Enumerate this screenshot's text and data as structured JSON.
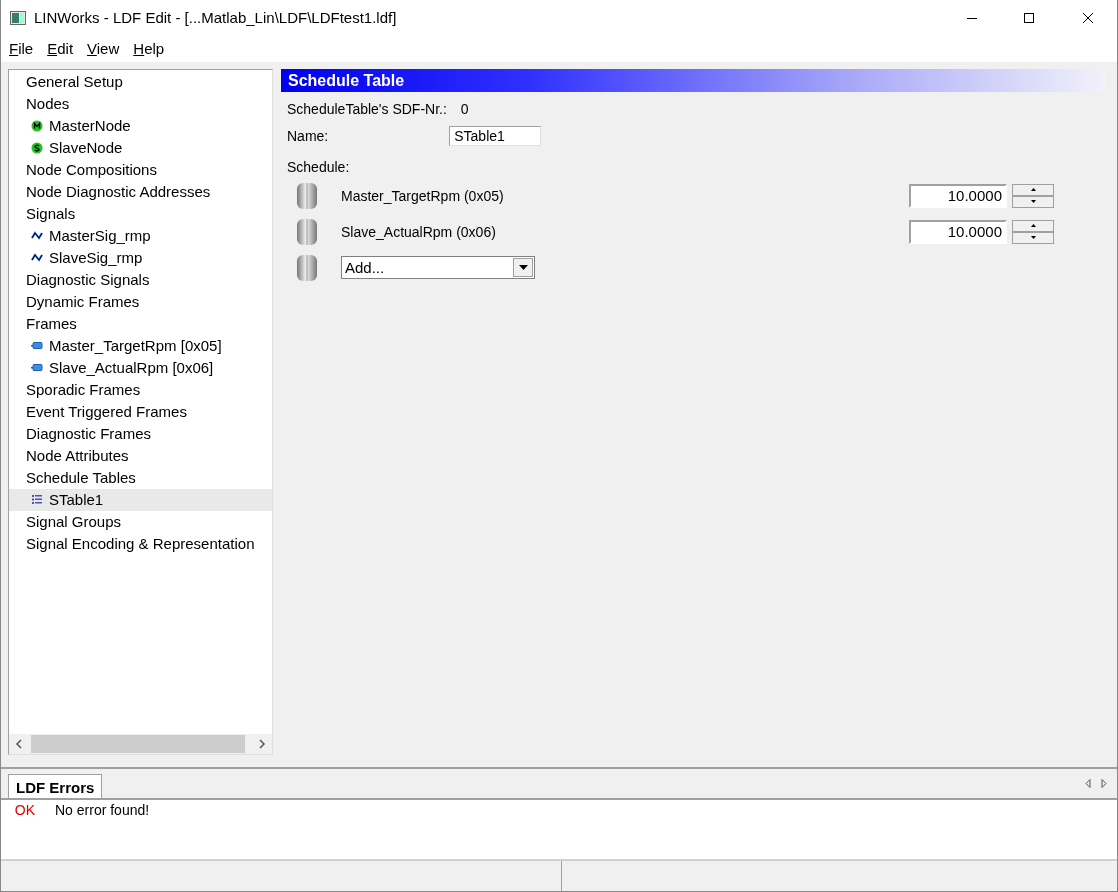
{
  "window": {
    "title": "LINWorks - LDF Edit - [...Matlab_Lin\\LDF\\LDFtest1.ldf]"
  },
  "menu": [
    "File",
    "Edit",
    "View",
    "Help"
  ],
  "tree": [
    {
      "label": "General Setup",
      "kind": "category",
      "selected": false
    },
    {
      "label": "Nodes",
      "kind": "category",
      "selected": false,
      "children": [
        {
          "label": "MasterNode",
          "kind": "master-node",
          "selected": false
        },
        {
          "label": "SlaveNode",
          "kind": "slave-node",
          "selected": false
        }
      ]
    },
    {
      "label": "Node Compositions",
      "kind": "category",
      "selected": false
    },
    {
      "label": "Node Diagnostic Addresses",
      "kind": "category",
      "selected": false
    },
    {
      "label": "Signals",
      "kind": "category",
      "selected": false,
      "children": [
        {
          "label": "MasterSig_rmp",
          "kind": "signal",
          "selected": false
        },
        {
          "label": "SlaveSig_rmp",
          "kind": "signal",
          "selected": false
        }
      ]
    },
    {
      "label": "Diagnostic Signals",
      "kind": "category",
      "selected": false
    },
    {
      "label": "Dynamic Frames",
      "kind": "category",
      "selected": false
    },
    {
      "label": "Frames",
      "kind": "category",
      "selected": false,
      "children": [
        {
          "label": "Master_TargetRpm [0x05]",
          "kind": "frame",
          "selected": false
        },
        {
          "label": "Slave_ActualRpm [0x06]",
          "kind": "frame",
          "selected": false
        }
      ]
    },
    {
      "label": "Sporadic Frames",
      "kind": "category",
      "selected": false
    },
    {
      "label": "Event Triggered Frames",
      "kind": "category",
      "selected": false
    },
    {
      "label": "Diagnostic Frames",
      "kind": "category",
      "selected": false
    },
    {
      "label": "Node Attributes",
      "kind": "category",
      "selected": false
    },
    {
      "label": "Schedule Tables",
      "kind": "category",
      "selected": false,
      "children": [
        {
          "label": "STable1",
          "kind": "schedule",
          "selected": true
        }
      ]
    },
    {
      "label": "Signal Groups",
      "kind": "category",
      "selected": false
    },
    {
      "label": "Signal Encoding & Representation",
      "kind": "category",
      "selected": false
    }
  ],
  "editor": {
    "header": "Schedule Table",
    "sdf_label": "ScheduleTable's SDF-Nr.:",
    "sdf_value": "0",
    "name_label": "Name:",
    "name_value": "STable1",
    "schedule_label": "Schedule:",
    "entries": [
      {
        "kind": "frame",
        "label": "Master_TargetRpm (0x05)",
        "value": "10.0000"
      },
      {
        "kind": "frame",
        "label": "Slave_ActualRpm (0x06)",
        "value": "10.0000"
      },
      {
        "kind": "add",
        "label": "Add..."
      }
    ]
  },
  "errors_panel": {
    "tabs": [
      {
        "label": "LDF Errors",
        "selected": true
      }
    ],
    "messages": [
      {
        "status": "OK",
        "text": "No error found!"
      }
    ]
  }
}
